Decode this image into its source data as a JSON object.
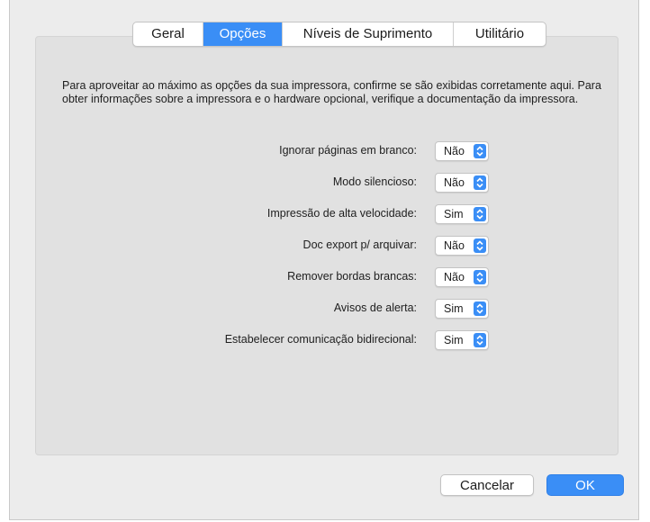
{
  "tabs": [
    {
      "label": "Geral",
      "active": false
    },
    {
      "label": "Opções",
      "active": true
    },
    {
      "label": "Níveis de Suprimento",
      "active": false
    },
    {
      "label": "Utilitário",
      "active": false
    }
  ],
  "description": "Para aproveitar ao máximo as opções da sua impressora, confirme se são exibidas corretamente aqui. Para obter informações sobre a impressora e o hardware opcional, verifique a documentação da impressora.",
  "options": [
    {
      "label": "Ignorar páginas em branco:",
      "value": "Não"
    },
    {
      "label": "Modo silencioso:",
      "value": "Não"
    },
    {
      "label": "Impressão de alta velocidade:",
      "value": "Sim"
    },
    {
      "label": "Doc export p/ arquivar:",
      "value": "Não"
    },
    {
      "label": "Remover bordas brancas:",
      "value": "Não"
    },
    {
      "label": "Avisos de alerta:",
      "value": "Sim"
    },
    {
      "label": "Estabelecer comunicação bidirecional:",
      "value": "Sim"
    }
  ],
  "buttons": {
    "cancel": "Cancelar",
    "ok": "OK"
  },
  "icons": {
    "popup_arrows": "up-down-chevron-icon"
  },
  "colors": {
    "accent": "#3a8ef6",
    "panel": "#e1e1e1",
    "window": "#ececec"
  }
}
